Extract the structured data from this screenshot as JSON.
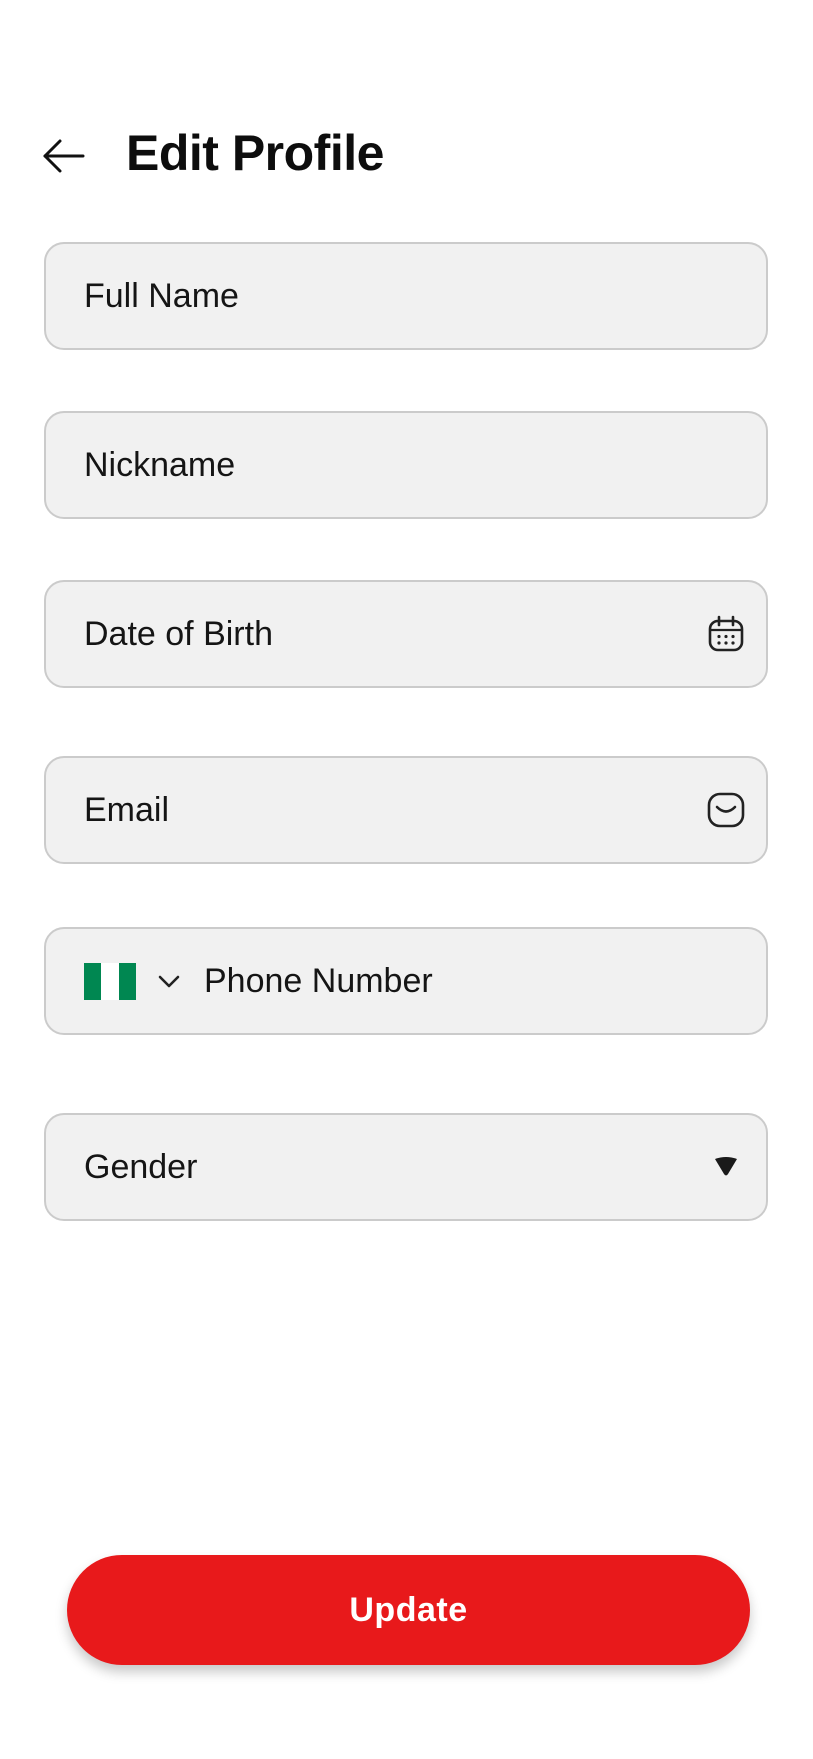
{
  "header": {
    "title": "Edit Profile",
    "back_icon": "arrow-left-icon"
  },
  "form": {
    "full_name": {
      "placeholder": "Full Name"
    },
    "nickname": {
      "placeholder": "Nickname"
    },
    "date_of_birth": {
      "placeholder": "Date of Birth",
      "icon": "calendar-icon"
    },
    "email": {
      "placeholder": "Email",
      "icon": "mail-icon"
    },
    "phone": {
      "placeholder": "Phone Number",
      "country_flag": "nigeria-flag",
      "flag_colors": [
        "#008751",
        "#ffffff",
        "#008751"
      ],
      "dropdown_icon": "chevron-down-icon"
    },
    "gender": {
      "placeholder": "Gender",
      "icon": "caret-down-icon"
    }
  },
  "actions": {
    "update_label": "Update",
    "accent_color": "#e8191b"
  }
}
